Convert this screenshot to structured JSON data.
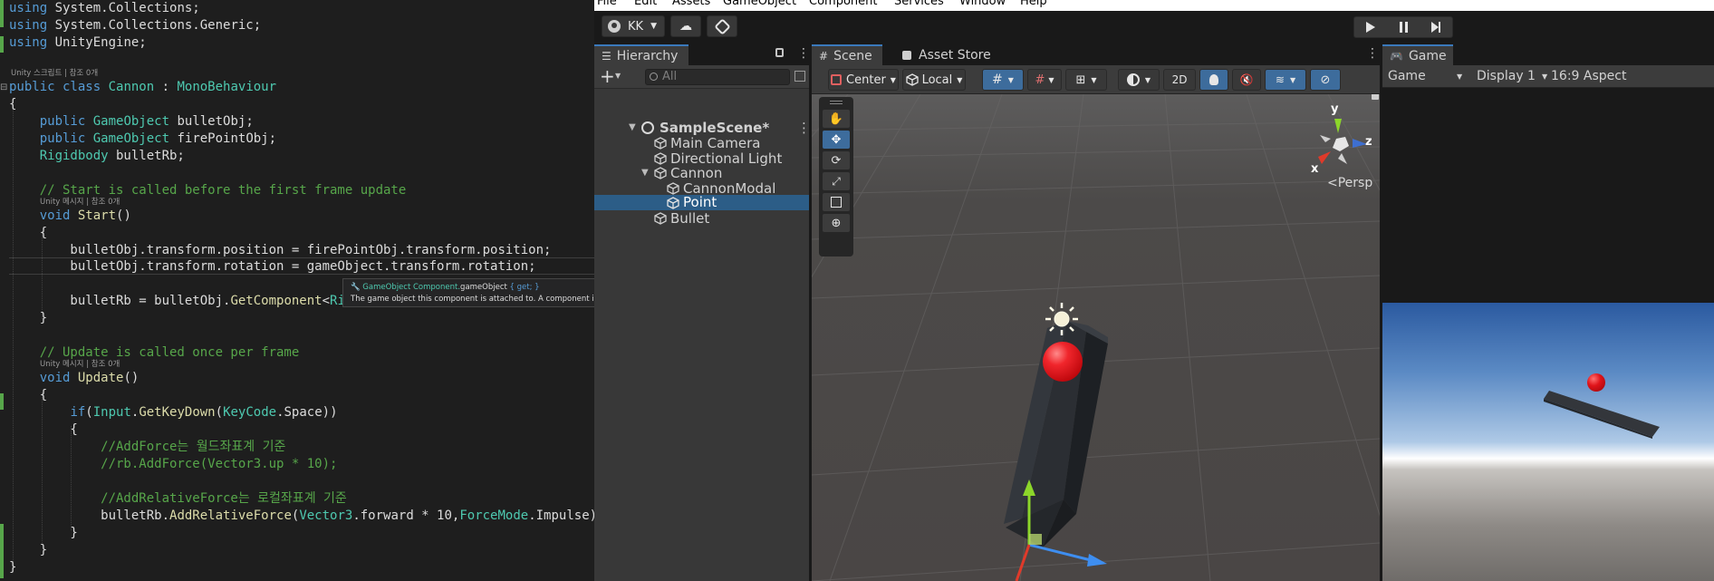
{
  "editor": {
    "code": [
      "using System.Collections;",
      "using System.Collections.Generic;",
      "using UnityEngine;",
      "public class Cannon : MonoBehaviour",
      "{",
      "    public GameObject bulletObj;",
      "    public GameObject firePointObj;",
      "    Rigidbody bulletRb;",
      "    // Start is called before the first frame update",
      "    void Start()",
      "    {",
      "        bulletObj.transform.position = firePointObj.transform.position;",
      "        bulletObj.transform.rotation = gameObject.transform.rotation;",
      "        bulletRb = bulletObj.GetComponent<Rig",
      "    }",
      "    // Update is called once per frame",
      "    void Update()",
      "    {",
      "        if(Input.GetKeyDown(KeyCode.Space))",
      "        {",
      "            //AddForce는 월드좌표계 기준",
      "            //rb.AddForce(Vector3.up * 10);",
      "            //AddRelativeForce는 로컬좌표계 기준",
      "            bulletRb.AddRelativeForce(Vector3.forward * 10,ForceMode.Impulse);",
      "        }",
      "    }",
      "}"
    ],
    "lens_class": "Unity 스크립트 | 참조 0개",
    "lens_start": "Unity 메시지 | 참조 0개",
    "lens_update": "Unity 메시지 | 참조 0개",
    "tooltip": {
      "category": "GameObject Component.",
      "member": "gameObject",
      "accessor": "{ get; }",
      "description": "The game object this component is attached to. A component is a"
    }
  },
  "unity": {
    "menu": [
      "File",
      "Edit",
      "Assets",
      "GameObject",
      "Component",
      "Services",
      "Window",
      "Help"
    ],
    "account": "KK",
    "hierarchy": {
      "tab": "Hierarchy",
      "search_placeholder": "All",
      "scene": "SampleScene*",
      "items": [
        "Main Camera",
        "Directional Light",
        "Cannon",
        "CannonModal",
        "Point",
        "Bullet"
      ],
      "selected": "Point"
    },
    "scene": {
      "tabs": [
        "Scene",
        "Asset Store"
      ],
      "pivot": "Center",
      "space": "Local",
      "mode_2d": "2D",
      "persp_label": "<Persp",
      "gizmo_x": "x",
      "gizmo_y": "y",
      "gizmo_z": "z"
    },
    "game": {
      "tab": "Game",
      "view": "Game",
      "display": "Display 1",
      "aspect": "16:9 Aspect"
    },
    "colors": {
      "selection": "#2c5d87",
      "accent": "#3a79bb",
      "ball": "#e0141a"
    }
  }
}
